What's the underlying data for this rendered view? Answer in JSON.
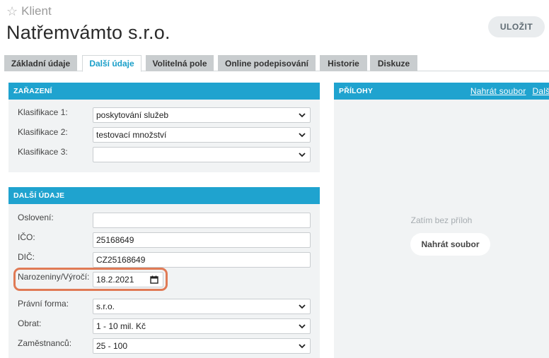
{
  "header": {
    "subtitle": "Klient",
    "title": "Natřemvámto s.r.o.",
    "save_label": "ULOŽIT"
  },
  "tabs": [
    {
      "label": "Základní údaje",
      "active": false
    },
    {
      "label": "Další údaje",
      "active": true
    },
    {
      "label": "Volitelná pole",
      "active": false
    },
    {
      "label": "Online podepisování",
      "active": false
    },
    {
      "label": "Historie",
      "active": false
    },
    {
      "label": "Diskuze",
      "active": false
    }
  ],
  "zarazeni": {
    "title": "ZAŘAZENÍ",
    "rows": [
      {
        "label": "Klasifikace 1:",
        "value": "poskytování služeb"
      },
      {
        "label": "Klasifikace 2:",
        "value": "testovací množství"
      },
      {
        "label": "Klasifikace 3:",
        "value": ""
      }
    ]
  },
  "dalsi": {
    "title": "DALŠÍ ÚDAJE",
    "osloveni": {
      "label": "Oslovení:",
      "value": ""
    },
    "ico": {
      "label": "IČO:",
      "value": "25168649"
    },
    "dic": {
      "label": "DIČ:",
      "value": "CZ25168649"
    },
    "narozeniny": {
      "label": "Narozeniny/Výročí:",
      "value": "18.2.2021"
    },
    "pravni_forma": {
      "label": "Právní forma:",
      "value": "s.r.o."
    },
    "obrat": {
      "label": "Obrat:",
      "value": "1 - 10 mil. Kč"
    },
    "zamestnancu": {
      "label": "Zaměstnanců:",
      "value": "25 - 100"
    }
  },
  "prilohy": {
    "title": "PŘÍLOHY",
    "upload_link": "Nahrát soubor",
    "more_link": "Další možnosti",
    "empty_text": "Zatím bez příloh",
    "upload_button": "Nahrát soubor"
  },
  "colors": {
    "accent": "#1fa3cf",
    "highlight": "#e07a55"
  }
}
